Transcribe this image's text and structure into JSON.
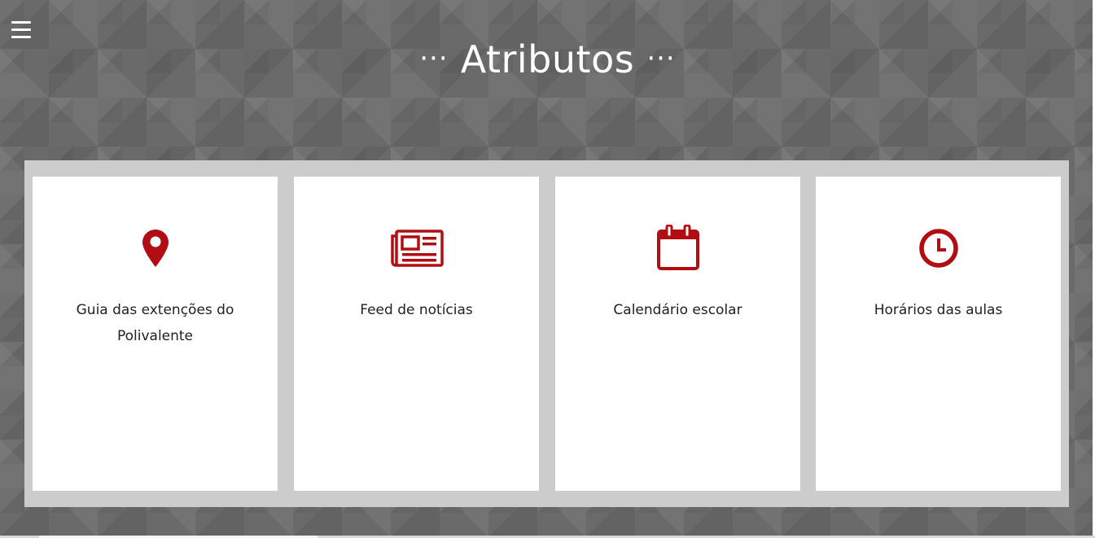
{
  "header": {
    "menu_icon": "hamburger-menu-icon",
    "title_prefix": "···",
    "title": "Atributos",
    "title_suffix": "···"
  },
  "accent_color": "#b20d12",
  "cards": [
    {
      "icon": "map-pin-icon",
      "label": "Guia das extenções do Polivalente"
    },
    {
      "icon": "newspaper-icon",
      "label": "Feed de notícias"
    },
    {
      "icon": "calendar-icon",
      "label": "Calendário escolar"
    },
    {
      "icon": "clock-icon",
      "label": "Horários das aulas"
    }
  ]
}
